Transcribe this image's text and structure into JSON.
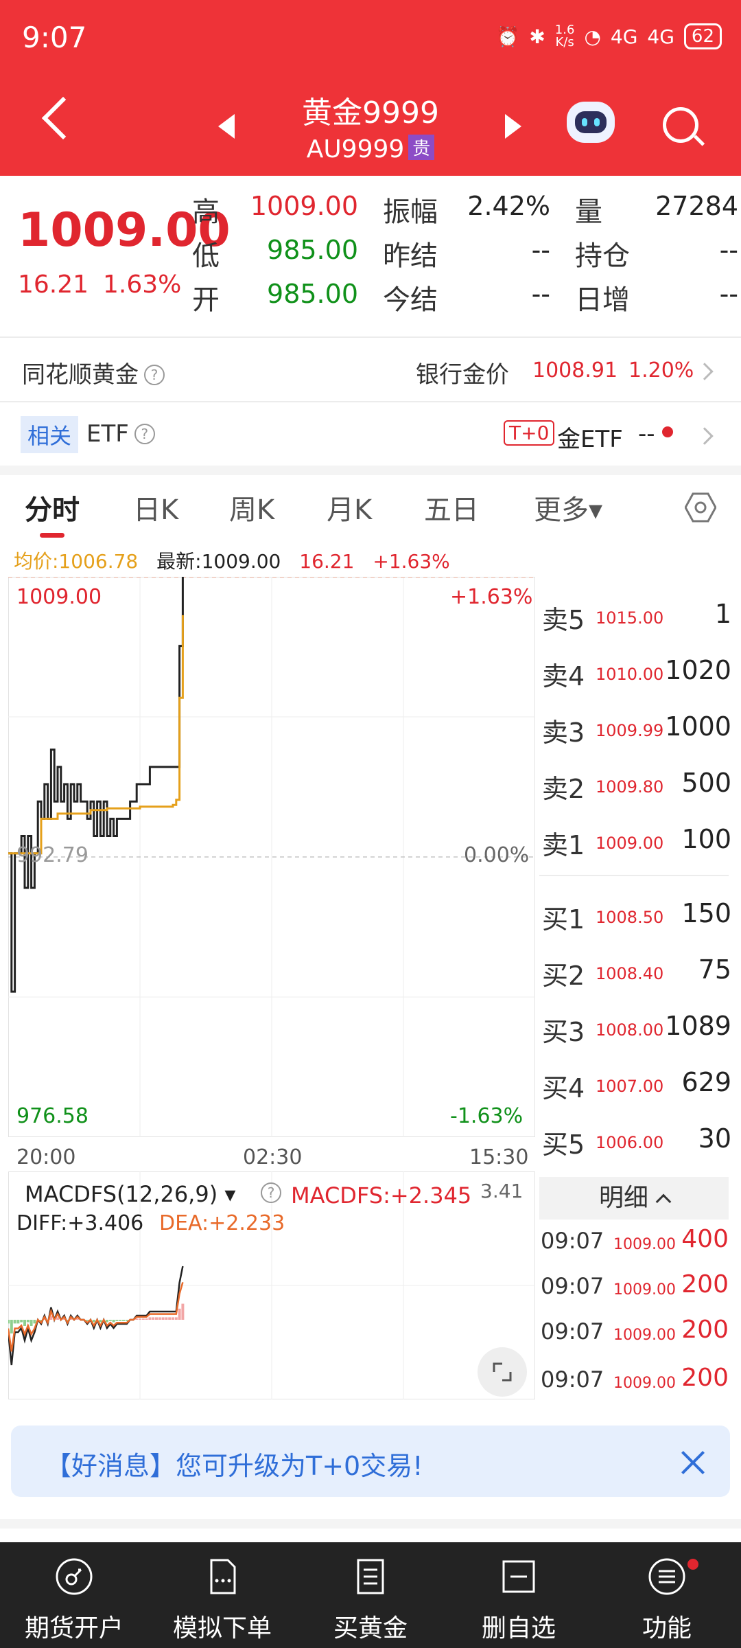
{
  "status_bar": {
    "time": "9:07",
    "speed_top": "1.6",
    "speed_bottom": "K/s",
    "signal_1": "4G",
    "signal_2": "4G",
    "battery": "62"
  },
  "header": {
    "title": "黄金9999",
    "subtitle": "AU9999",
    "badge": "贵"
  },
  "quote": {
    "price": "1009.00",
    "change": "16.21",
    "change_pct": "1.63%",
    "fields": [
      {
        "label": "高",
        "value": "1009.00",
        "color": "#e0262f"
      },
      {
        "label": "低",
        "value": "985.00",
        "color": "#10911a"
      },
      {
        "label": "开",
        "value": "985.00",
        "color": "#10911a"
      },
      {
        "label": "振幅",
        "value": "2.42%",
        "color": "#222222"
      },
      {
        "label": "昨结",
        "value": "--",
        "color": "#222222"
      },
      {
        "label": "今结",
        "value": "--",
        "color": "#222222"
      },
      {
        "label": "量",
        "value": "27284",
        "color": "#222222"
      },
      {
        "label": "持仓",
        "value": "--",
        "color": "#222222"
      },
      {
        "label": "日增",
        "value": "--",
        "color": "#222222"
      }
    ]
  },
  "info_row": {
    "left_label": "同花顺黄金",
    "help": "?",
    "bank_label": "银行金价",
    "bank_price": "1008.91",
    "bank_pct": "1.20%"
  },
  "etf_row": {
    "tag": "相关",
    "label": "ETF",
    "help": "?",
    "t0": "T+0",
    "etf_name": "金ETF",
    "etf_value": "--"
  },
  "tabs": [
    "分时",
    "日K",
    "周K",
    "月K",
    "五日",
    "更多▾"
  ],
  "chart_info": {
    "avg_label": "均价:1006.78",
    "latest_label": "最新:1009.00",
    "change": "16.21",
    "pct": "+1.63%"
  },
  "chart_data": {
    "type": "line",
    "y_top_label": "1009.00",
    "y_mid_label": "992.79",
    "y_bottom_label": "976.58",
    "pct_top_label": "+1.63%",
    "pct_mid_label": "0.00%",
    "pct_bottom_label": "-1.63%",
    "x_labels": [
      "20:00",
      "02:30",
      "15:30"
    ],
    "ylim": [
      976.58,
      1009.0
    ],
    "reference": 992.79,
    "series": [
      {
        "color": "#222222",
        "x": [
          0,
          1,
          2,
          3,
          4,
          5,
          6,
          7,
          8,
          9,
          10,
          11,
          12,
          13,
          14,
          15,
          16,
          17,
          18,
          19,
          20,
          21,
          22,
          23,
          24,
          25,
          26,
          27,
          28,
          29,
          30,
          31,
          32,
          33,
          34,
          35,
          36,
          37,
          38,
          39,
          40,
          41,
          42,
          43,
          44,
          45,
          46,
          47,
          48,
          49,
          50,
          51,
          52,
          53
        ],
        "y": [
          993,
          985,
          993,
          993,
          994,
          991,
          994,
          991,
          993,
          996,
          995,
          997,
          995,
          999,
          996,
          998,
          996,
          997,
          995,
          997,
          996,
          997,
          996,
          996,
          995,
          996,
          994,
          996,
          994,
          996,
          994,
          995,
          994,
          995,
          995,
          995,
          995,
          996,
          996,
          997,
          997,
          997,
          997,
          998,
          998,
          998,
          998,
          998,
          998,
          998,
          998,
          998,
          1005,
          1009
        ]
      },
      {
        "color": "#e5a01b",
        "x": [
          0,
          5,
          10,
          15,
          20,
          25,
          30,
          35,
          40,
          45,
          50,
          51,
          52,
          53
        ],
        "y": [
          993,
          993,
          995,
          995.3,
          995.3,
          995.5,
          995.6,
          995.6,
          995.7,
          995.7,
          995.8,
          996.1,
          1002,
          1006.78
        ]
      }
    ]
  },
  "macd": {
    "label": "MACDFS(12,26,9)",
    "help": "?",
    "macdfs": "MACDFS:+2.345",
    "top_value": "3.41",
    "diff": "DIFF:+3.406",
    "dea": "DEA:+2.233"
  },
  "order_book": {
    "asks": [
      {
        "label": "卖5",
        "price": "1015.00",
        "vol": "1"
      },
      {
        "label": "卖4",
        "price": "1010.00",
        "vol": "1020"
      },
      {
        "label": "卖3",
        "price": "1009.99",
        "vol": "1000"
      },
      {
        "label": "卖2",
        "price": "1009.80",
        "vol": "500"
      },
      {
        "label": "卖1",
        "price": "1009.00",
        "vol": "100"
      }
    ],
    "bids": [
      {
        "label": "买1",
        "price": "1008.50",
        "vol": "150"
      },
      {
        "label": "买2",
        "price": "1008.40",
        "vol": "75"
      },
      {
        "label": "买3",
        "price": "1008.00",
        "vol": "1089"
      },
      {
        "label": "买4",
        "price": "1007.00",
        "vol": "629"
      },
      {
        "label": "买5",
        "price": "1006.00",
        "vol": "30"
      }
    ]
  },
  "details": {
    "title": "明细",
    "rows": [
      {
        "time": "09:07",
        "price": "1009.00",
        "vol": "400"
      },
      {
        "time": "09:07",
        "price": "1009.00",
        "vol": "200"
      },
      {
        "time": "09:07",
        "price": "1009.00",
        "vol": "200"
      },
      {
        "time": "09:07",
        "price": "1009.00",
        "vol": "200"
      }
    ]
  },
  "banner": {
    "text": "【好消息】您可升级为T+0交易!"
  },
  "bottom_nav": [
    {
      "label": "期货开户",
      "icon": "account-open-icon"
    },
    {
      "label": "模拟下单",
      "icon": "document-icon"
    },
    {
      "label": "买黄金",
      "icon": "list-icon"
    },
    {
      "label": "删自选",
      "icon": "remove-favorite-icon"
    },
    {
      "label": "功能",
      "icon": "menu-icon"
    }
  ]
}
